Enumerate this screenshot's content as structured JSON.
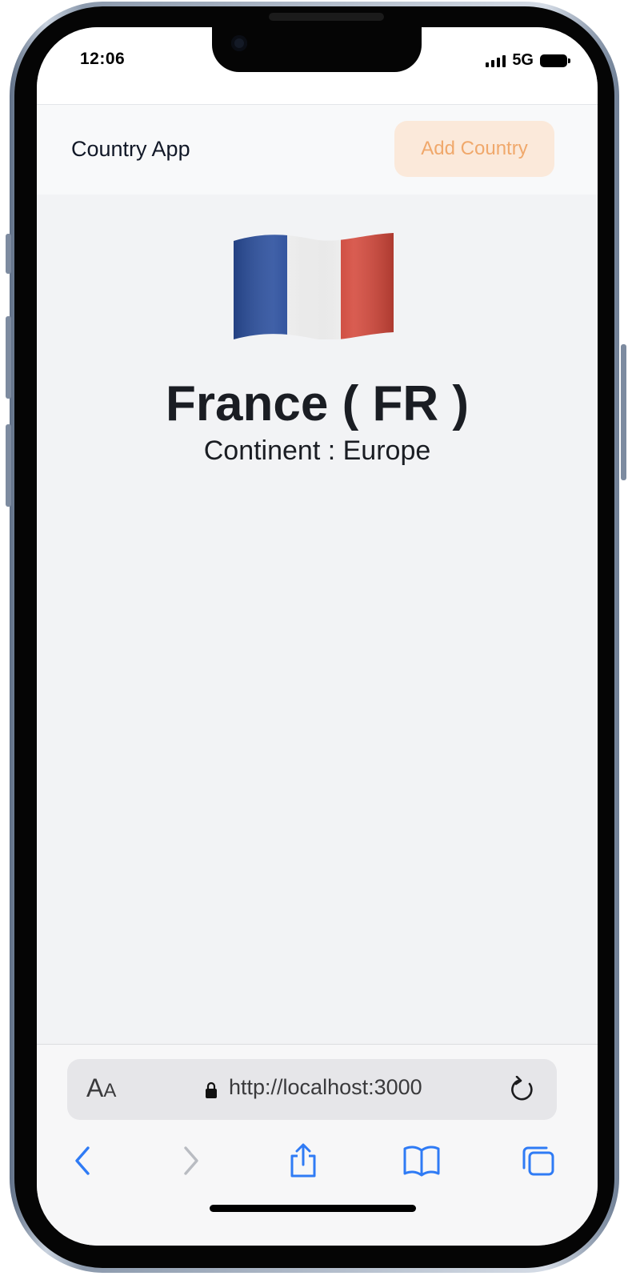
{
  "status_bar": {
    "time": "12:06",
    "network": "5G"
  },
  "app": {
    "title": "Country App",
    "add_button_label": "Add Country"
  },
  "country": {
    "name_line": "France ( FR )",
    "continent_line": "Continent : Europe",
    "flag_colors": [
      "#2b4f9e",
      "#f4f4f4",
      "#d4473a"
    ]
  },
  "browser": {
    "aa_label_big": "A",
    "aa_label_small": "A",
    "url": "http://localhost:3000",
    "accent": "#2f7bf5",
    "icons": [
      "back-icon",
      "forward-icon",
      "share-icon",
      "bookmarks-icon",
      "tabs-icon",
      "reload-icon",
      "lock-icon"
    ]
  }
}
